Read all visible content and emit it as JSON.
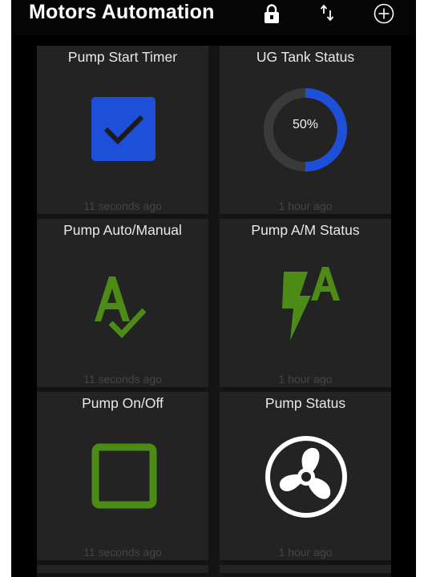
{
  "app": {
    "title": "Motors Automation"
  },
  "toolbar": {
    "icons": [
      "lock-icon",
      "sort-arrows-icon",
      "add-circle-icon"
    ]
  },
  "tiles": [
    {
      "title": "Pump Start Timer",
      "time": "11 seconds ago",
      "widget": "checkbox-checked",
      "color": "#1e4fd8"
    },
    {
      "title": "UG Tank Status",
      "time": "1 hour ago",
      "widget": "gauge",
      "value": "50%",
      "progress": 0.5,
      "color": "#1e4fd8"
    },
    {
      "title": "Pump Auto/Manual",
      "time": "11 seconds ago",
      "widget": "auto-check-icon",
      "color": "#4c8c16"
    },
    {
      "title": "Pump A/M Status",
      "time": "1 hour ago",
      "widget": "lightning-a-icon",
      "color": "#4c8c16"
    },
    {
      "title": "Pump On/Off",
      "time": "11 seconds ago",
      "widget": "checkbox-unchecked",
      "color": "#4c8c16"
    },
    {
      "title": "Pump Status",
      "time": "1 hour ago",
      "widget": "fan-icon",
      "color": "#ffffff"
    }
  ]
}
